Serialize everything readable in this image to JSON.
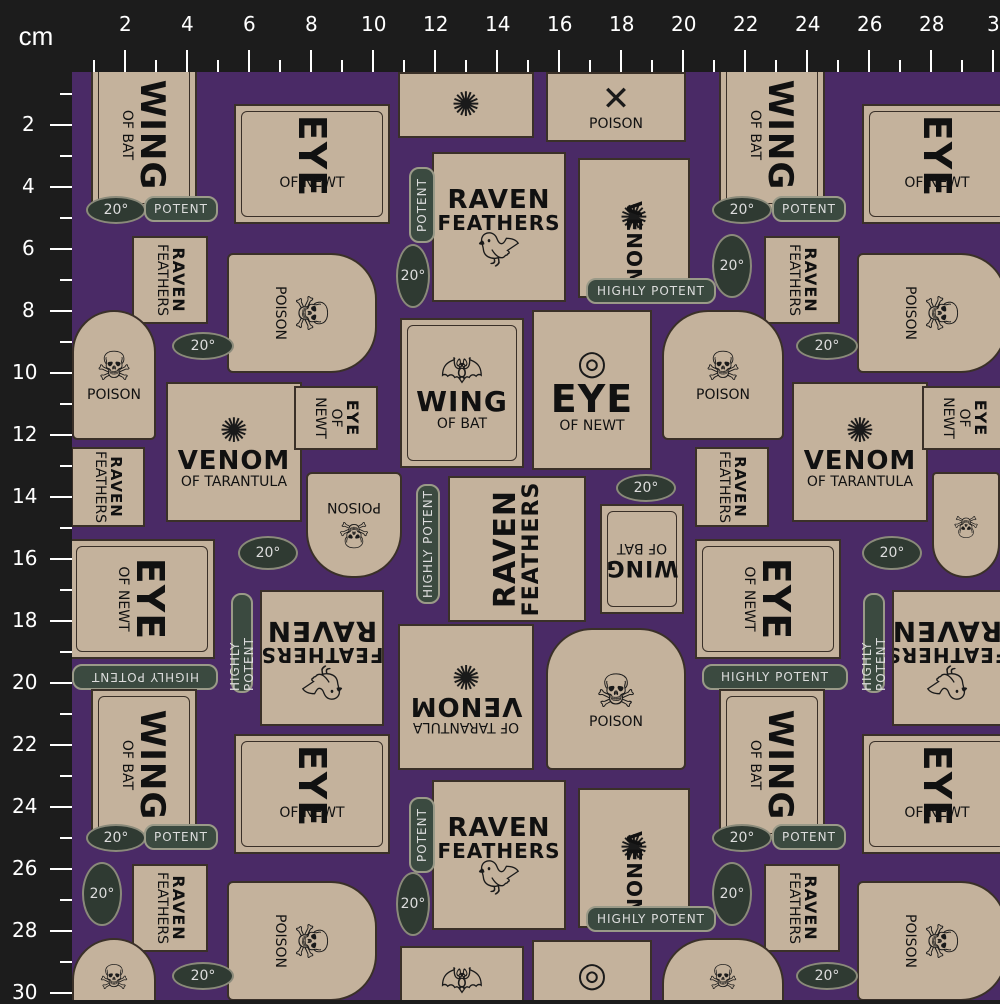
{
  "ruler": {
    "unit": "cm",
    "top_ticks": [
      "2",
      "4",
      "6",
      "8",
      "10",
      "12",
      "14",
      "16",
      "18",
      "20",
      "22",
      "24",
      "26",
      "28",
      "3"
    ],
    "left_ticks": [
      "2",
      "4",
      "6",
      "8",
      "10",
      "12",
      "14",
      "16",
      "18",
      "20",
      "22",
      "24",
      "26",
      "28",
      "30"
    ]
  },
  "labels": {
    "raven": "RAVEN",
    "feathers": "FEATHERS",
    "eye": "EYE",
    "of_newt": "OF NEWT",
    "wing": "WING",
    "of_bat": "OF BAT",
    "venom": "VENOM",
    "of_tarantula": "OF TARANTULA",
    "poison": "POISON",
    "potent": "POTENT",
    "highly_potent": "HIGHLY POTENT",
    "twenty_deg": "20°"
  },
  "icons": {
    "skull": "skull-crossbones-icon",
    "spider": "spider-icon",
    "raven": "raven-icon",
    "bat": "bat-icon",
    "eye_web": "spiderweb-icon"
  },
  "colors": {
    "background_purple": "#4a2a66",
    "label_tan": "#c4b29c",
    "ink": "#111111",
    "ruler_black": "#1c1c1c"
  }
}
